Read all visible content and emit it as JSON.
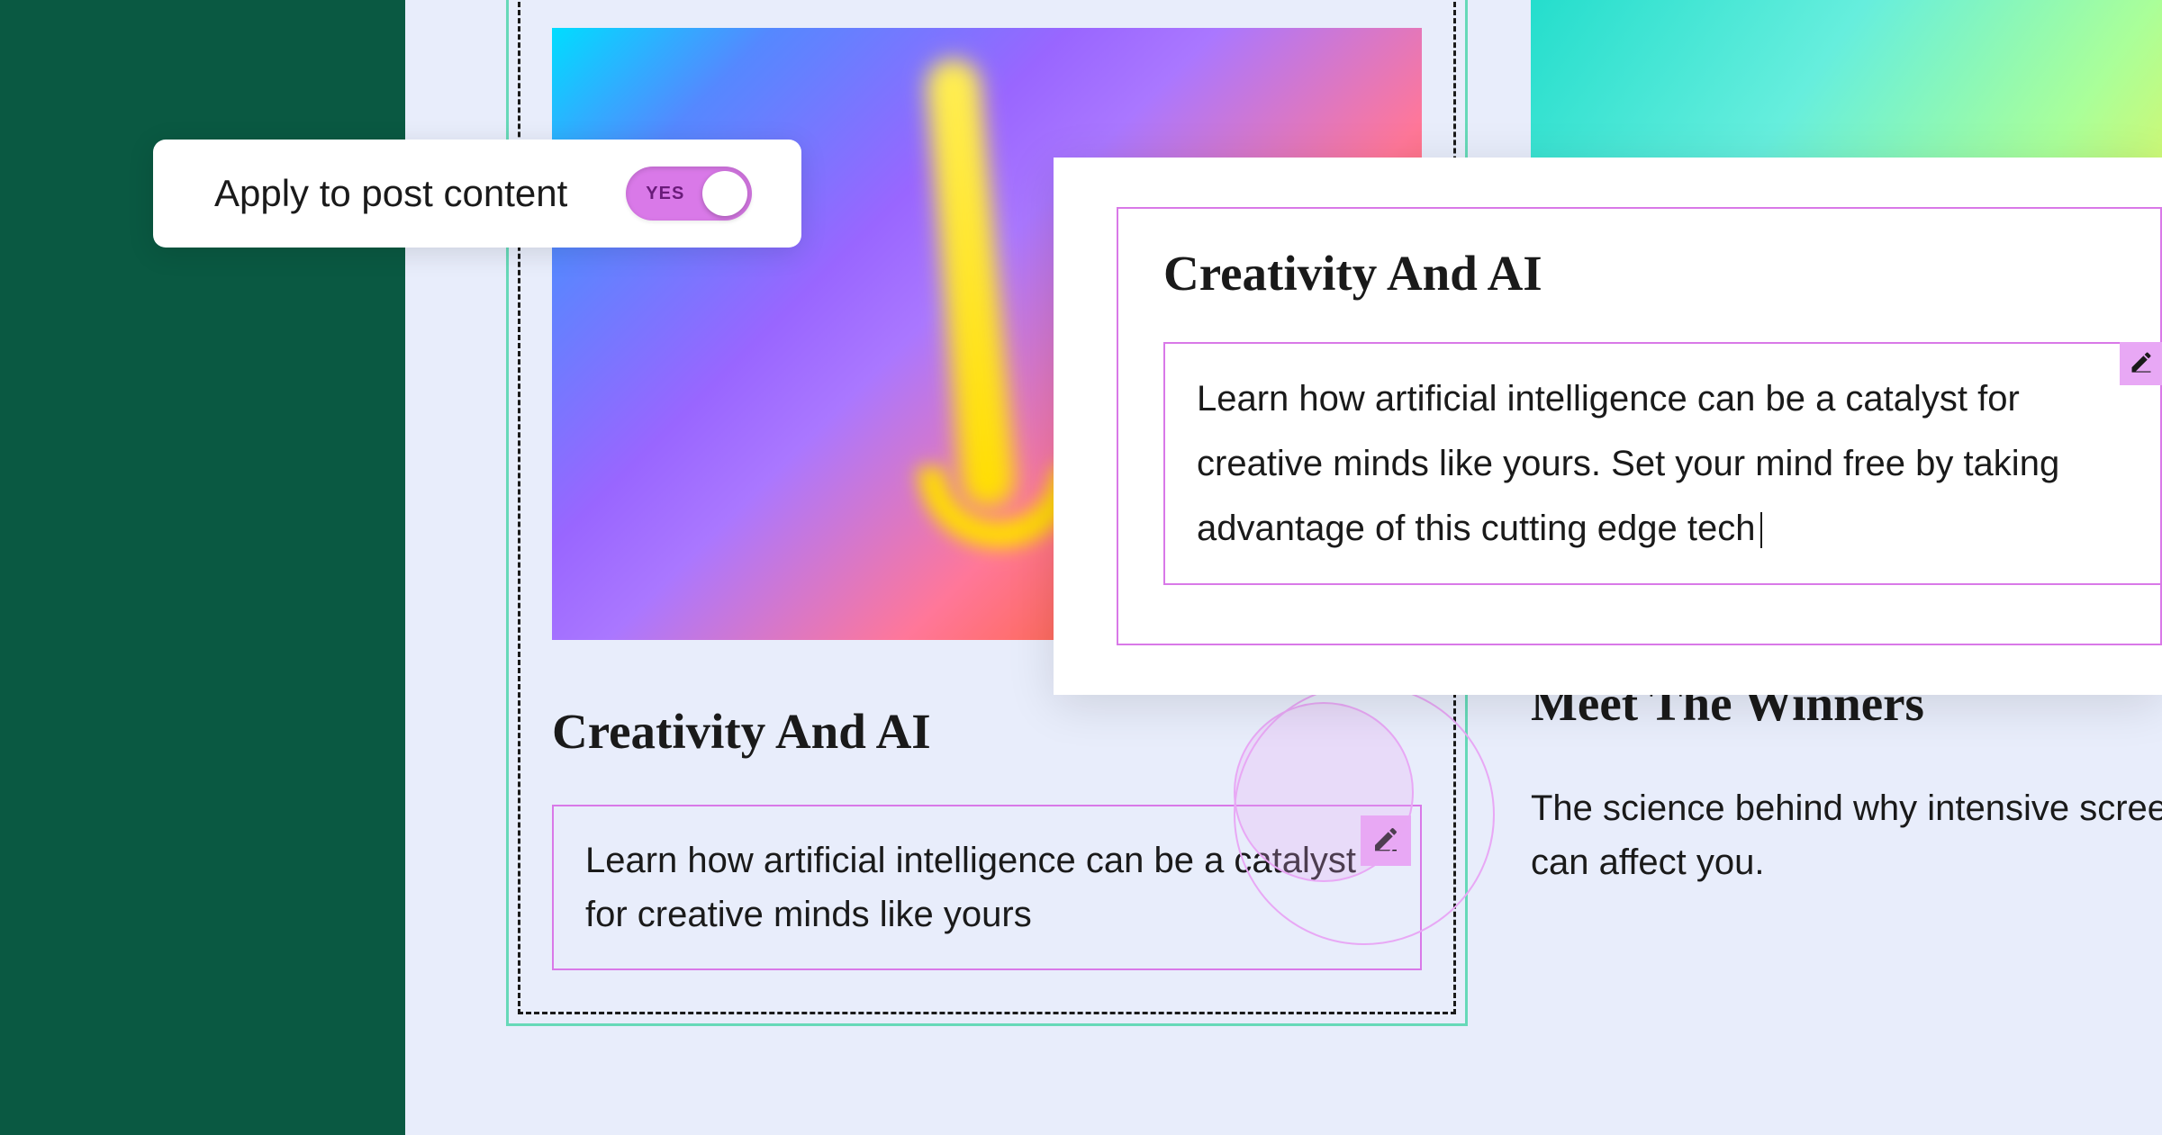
{
  "toggle": {
    "label": "Apply to post content",
    "value_text": "YES",
    "enabled": true
  },
  "main_card": {
    "title": "Creativity And AI",
    "description": "Learn how artificial intelligence can be a catalyst for creative minds like yours"
  },
  "second_card": {
    "title": "Meet The Winners",
    "description": "The science behind why intensive screens can affect you."
  },
  "editor": {
    "title": "Creativity And AI",
    "text": "Learn how artificial intelligence can be a catalyst for creative minds like yours. Set your mind free by taking advantage of this cutting edge tech"
  }
}
